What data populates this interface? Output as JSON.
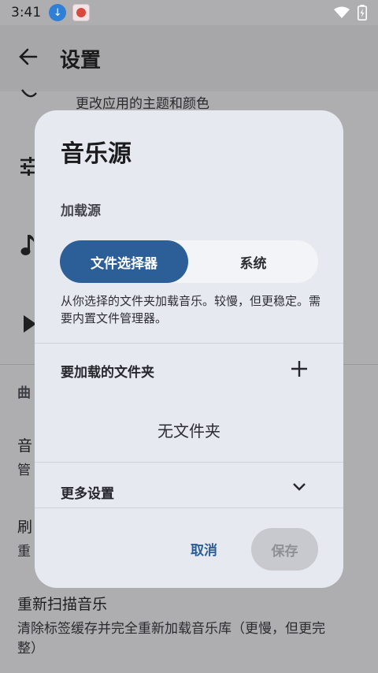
{
  "status_bar": {
    "time": "3:41"
  },
  "app_bar": {
    "title": "设置"
  },
  "background": {
    "theme_subtitle": "更改应用的主题和颜色",
    "section_fragment": "曲",
    "row1_fragment": "音",
    "row1_sub_fragment": "管",
    "row2_fragment": "刷",
    "row2_sub_fragment": "重",
    "rescan_title": "重新扫描音乐",
    "rescan_subtitle_line1": "清除标签缓存并完全重新加载音乐库（更慢，但更完",
    "rescan_subtitle_line2": "整）"
  },
  "dialog": {
    "title": "音乐源",
    "load_source_label": "加载源",
    "options": [
      {
        "label": "文件选择器",
        "selected": true
      },
      {
        "label": "系统",
        "selected": false
      }
    ],
    "description": "从你选择的文件夹加载音乐。较慢，但更稳定。需要内置文件管理器。",
    "folders_label": "要加载的文件夹",
    "no_folders": "无文件夹",
    "more_settings": "更多设置",
    "cancel": "取消",
    "save": "保存"
  },
  "colors": {
    "accent": "#2c5e97",
    "dialog_bg": "#e6e9f0",
    "scrim": "#aeaeb1"
  },
  "icons": [
    "download-icon",
    "app-notification-icon",
    "wifi-icon",
    "battery-icon",
    "back-arrow-icon",
    "palette-icon",
    "equalizer-icon",
    "music-note-icon",
    "play-icon",
    "add-icon",
    "chevron-down-icon"
  ]
}
